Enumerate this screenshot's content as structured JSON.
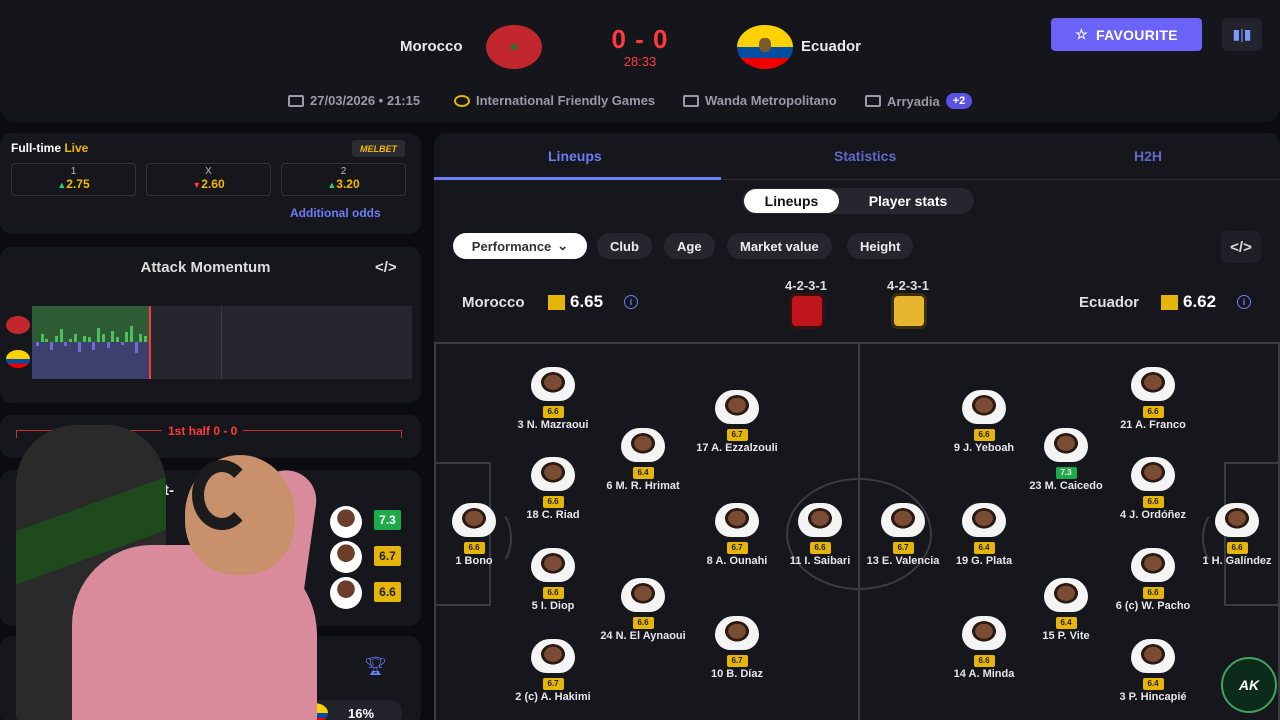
{
  "match": {
    "home": "Morocco",
    "away": "Ecuador",
    "score": "0 - 0",
    "clock": "28:33",
    "date": "27/03/2026 • 21:15",
    "competition": "International Friendly Games",
    "venue": "Wanda Metropolitano",
    "referee": "Arryadia",
    "more_badge": "+2"
  },
  "header": {
    "favourite_label": "FAVOURITE"
  },
  "odds": {
    "title": "Full-time",
    "live": "Live",
    "bookmaker": "MELBET",
    "options": [
      {
        "label": "1",
        "value": "2.75",
        "trend": "up"
      },
      {
        "label": "X",
        "value": "2.60",
        "trend": "down"
      },
      {
        "label": "2",
        "value": "3.20",
        "trend": "up"
      }
    ],
    "additional": "Additional odds"
  },
  "momentum": {
    "title": "Attack Momentum"
  },
  "half": {
    "label": "1st half 0 - 0"
  },
  "highest_rated": {
    "title": "Highest-",
    "ratings": [
      "7.3",
      "6.7",
      "6.6"
    ]
  },
  "win_prob": {
    "away_pct": "16%"
  },
  "tabs": [
    "Lineups",
    "Statistics",
    "H2H"
  ],
  "subtabs": [
    "Lineups",
    "Player stats"
  ],
  "filters": [
    "Performance",
    "Club",
    "Age",
    "Market value",
    "Height"
  ],
  "team_ratings": {
    "home": {
      "name": "Morocco",
      "rating": "6.65",
      "formation": "4-2-3-1"
    },
    "away": {
      "name": "Ecuador",
      "rating": "6.62",
      "formation": "4-2-3-1"
    }
  },
  "colors": {
    "accent": "#6d7cf7",
    "live": "#ff3b3b",
    "rating_green": "#1faa4a",
    "rating_yellow": "#e5b50a"
  },
  "home_players": [
    {
      "label": "1 Bono",
      "rating": "6.6"
    },
    {
      "label": "3 N. Mazraoui",
      "rating": "6.6"
    },
    {
      "label": "18 C. Riad",
      "rating": "6.6"
    },
    {
      "label": "5 I. Diop",
      "rating": "6.6"
    },
    {
      "label": "2 (c) A. Hakimi",
      "rating": "6.7"
    },
    {
      "label": "6 M. R. Hrimat",
      "rating": "6.4"
    },
    {
      "label": "24 N. El Aynaoui",
      "rating": "6.6"
    },
    {
      "label": "17 A. Ezzalzouli",
      "rating": "6.7"
    },
    {
      "label": "8 A. Ounahi",
      "rating": "6.7"
    },
    {
      "label": "10 B. Díaz",
      "rating": "6.7"
    },
    {
      "label": "11 I. Saibari",
      "rating": "6.6"
    }
  ],
  "away_players": [
    {
      "label": "13 E. Valencia",
      "rating": "6.7"
    },
    {
      "label": "9 J. Yeboah",
      "rating": "6.6"
    },
    {
      "label": "19 G. Plata",
      "rating": "6.4"
    },
    {
      "label": "14 A. Minda",
      "rating": "6.6"
    },
    {
      "label": "23 M. Caicedo",
      "rating": "7.3"
    },
    {
      "label": "15 P. Vite",
      "rating": "6.4"
    },
    {
      "label": "21 A. Franco",
      "rating": "6.6"
    },
    {
      "label": "4 J. Ordóñez",
      "rating": "6.6"
    },
    {
      "label": "6 (c) W. Pacho",
      "rating": "6.6"
    },
    {
      "label": "3 P. Hincapié",
      "rating": "6.4"
    },
    {
      "label": "1 H. Galíndez",
      "rating": "6.6"
    }
  ],
  "watermark": "AK"
}
